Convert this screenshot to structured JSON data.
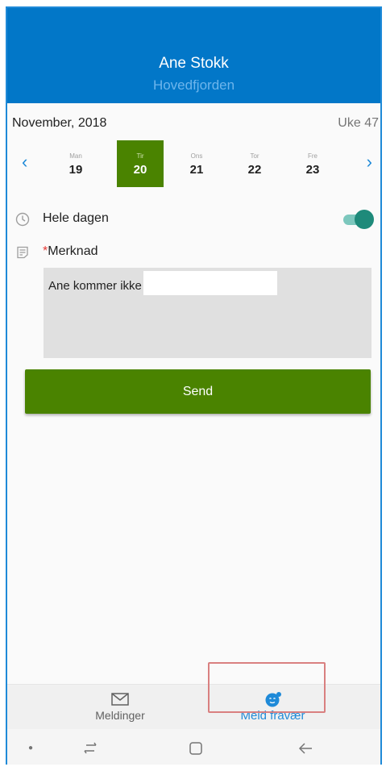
{
  "header": {
    "name": "Ane Stokk",
    "location": "Hovedfjorden",
    "bg_color": "#0277c8"
  },
  "calendar": {
    "month_label": "November, 2018",
    "week_label": "Uke 47",
    "prev_icon": "chevron-left-icon",
    "next_icon": "chevron-right-icon",
    "days": [
      {
        "name": "Man",
        "number": "19",
        "selected": false
      },
      {
        "name": "Tir",
        "number": "20",
        "selected": true
      },
      {
        "name": "Ons",
        "number": "21",
        "selected": false
      },
      {
        "name": "Tor",
        "number": "22",
        "selected": false
      },
      {
        "name": "Fre",
        "number": "23",
        "selected": false
      }
    ],
    "selected_color": "#4a8300"
  },
  "all_day": {
    "label": "Hele dagen",
    "icon": "clock-icon",
    "enabled": true
  },
  "note": {
    "required_marker": "*",
    "label": "Merknad",
    "icon": "note-icon",
    "value": "Ane kommer ikke"
  },
  "send_button": {
    "label": "Send",
    "color": "#4a8300"
  },
  "bottom_nav": {
    "messages": {
      "label": "Meldinger",
      "icon": "envelope-icon"
    },
    "absence": {
      "label": "Meld fravær",
      "icon": "absence-icon",
      "active": true
    }
  },
  "system_nav": {
    "recent_icon": "recent-apps-icon",
    "home_icon": "home-icon",
    "back_icon": "back-icon"
  }
}
